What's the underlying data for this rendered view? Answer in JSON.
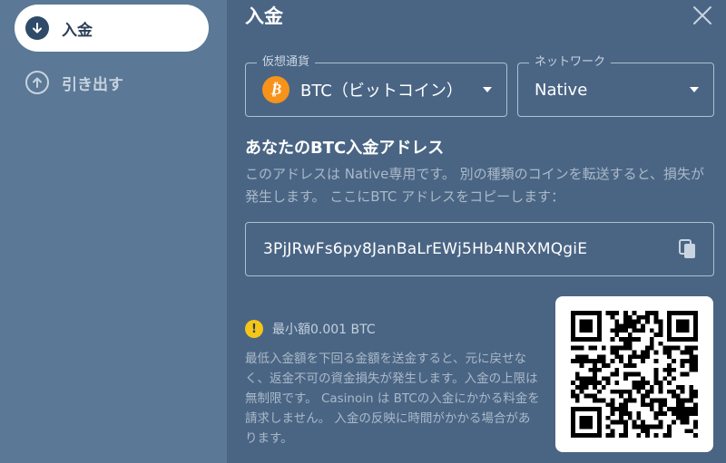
{
  "sidebar": {
    "items": [
      {
        "label": "入金",
        "icon": "arrow-down-circle-icon",
        "active": true
      },
      {
        "label": "引き出す",
        "icon": "arrow-up-circle-icon",
        "active": false
      }
    ]
  },
  "main": {
    "title": "入金",
    "currency": {
      "legend": "仮想通貨",
      "value": "BTC（ビットコイン）",
      "icon": "bitcoin-icon",
      "icon_glyph": "₿",
      "icon_color": "#f7931a"
    },
    "network": {
      "legend": "ネットワーク",
      "value": "Native"
    },
    "address_heading": "あなたのBTC入金アドレス",
    "address_description": "このアドレスは Native専用です。 別の種類のコインを転送すると、損失が発生します。 ここにBTC アドレスをコピーします：",
    "address": "3PjJRwFs6py8JanBaLrEWj5Hb4NRXMQgiE",
    "min_amount": "最小額0.001 BTC",
    "warning_glyph": "!",
    "notice": "最低入金額を下回る金額を送金すると、元に戻せなく、返金不可の資金損失が発生します。入金の上限は無制限です。 Casinoin は BTCの入金にかかる料金を請求しません。 入金の反映に時間がかかる場合があります。"
  },
  "colors": {
    "background": "#4a6584",
    "sidebar": "#5b7896",
    "accent_bitcoin": "#f7931a",
    "warning": "#f5c518"
  }
}
